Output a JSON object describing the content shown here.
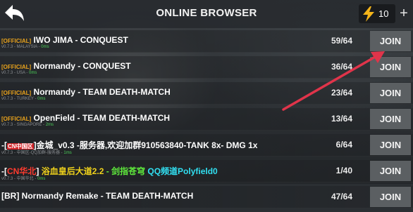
{
  "header": {
    "title": "ONLINE BROWSER",
    "energy_count": "10",
    "plus_label": "+",
    "back_icon": "back-arrow-icon",
    "energy_icon": "lightning-bolt-icon"
  },
  "colors": {
    "join_button_bg": "#5b5f62",
    "annotation_arrow": "#e0344a",
    "official_tag": "#e8a21c",
    "ping_good": "#4cd05a"
  },
  "join_label": "JOIN",
  "servers": [
    {
      "segments": [
        {
          "text": "[OFFICIAL]",
          "style": "tag-off"
        },
        {
          "text": " IWO JIMA - CONQUEST",
          "style": ""
        }
      ],
      "info_prefix": "v0.7.3 - MALAYSIA -",
      "ping": "0ms",
      "players": "59/64"
    },
    {
      "segments": [
        {
          "text": "[OFFICIAL]",
          "style": "tag-off"
        },
        {
          "text": " Normandy - CONQUEST",
          "style": ""
        }
      ],
      "info_prefix": "v0.7.3 - USA -",
      "ping": "0ms",
      "players": "36/64"
    },
    {
      "segments": [
        {
          "text": "[OFFICIAL]",
          "style": "tag-off"
        },
        {
          "text": " Normandy - TEAM DEATH-MATCH",
          "style": ""
        }
      ],
      "info_prefix": "v0.7.3 - TURKEY -",
      "ping": "0ms",
      "players": "23/64"
    },
    {
      "segments": [
        {
          "text": "[OFFICIAL]",
          "style": "tag-off"
        },
        {
          "text": " OpenField - TEAM DEATH-MATCH",
          "style": ""
        }
      ],
      "info_prefix": "v0.7.3 - SINGAPORE -",
      "ping": "2ms",
      "players": "13/64"
    },
    {
      "segments": [
        {
          "text": "-[",
          "style": ""
        },
        {
          "text": "CN中国区",
          "style": "tag-cn"
        },
        {
          "text": "]金城_v0.3 -服务器,欢迎加群910563840-TANK 8x- DMG 1x",
          "style": ""
        }
      ],
      "info_prefix": "v0.7.3 - 中国区-QQ加群-服务器 -",
      "ping": "1ms",
      "players": "6/64"
    },
    {
      "segments": [
        {
          "text": "-[",
          "style": ""
        },
        {
          "text": "CN华北",
          "style": "hl-red"
        },
        {
          "text": "] ",
          "style": ""
        },
        {
          "text": "浴血皇后大道2.2",
          "style": "hl-yellow"
        },
        {
          "text": " - 剑指苍穹 ",
          "style": "hl-green"
        },
        {
          "text": "QQ频道Polyfield0",
          "style": "hl-cyan"
        }
      ],
      "info_prefix": "v0.7.3 - 中国华北 -",
      "ping": "0ms",
      "players": "1/40"
    },
    {
      "segments": [
        {
          "text": "[BR] Normandy Remake - TEAM DEATH-MATCH",
          "style": ""
        }
      ],
      "info_prefix": "",
      "ping": "",
      "players": "47/64"
    }
  ]
}
